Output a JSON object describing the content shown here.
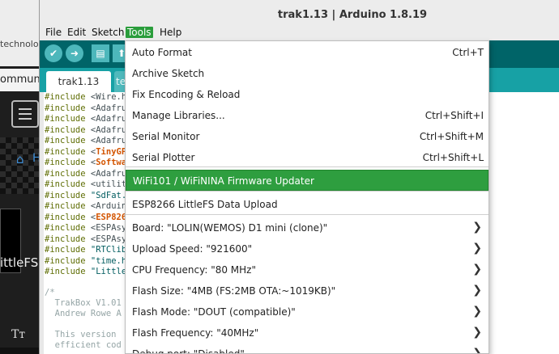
{
  "background": {
    "tab_text": "technolo",
    "community_text": "ommunit",
    "home_h": "H",
    "littlefs_text": "ittleFS",
    "tt_glyph": "Tт"
  },
  "window": {
    "title": "trak1.13 | Arduino 1.8.19"
  },
  "menubar": {
    "items": [
      "File",
      "Edit",
      "Sketch",
      "Tools",
      "Help"
    ],
    "active": "Tools"
  },
  "tabs": {
    "active": "trak1.13",
    "second": "te"
  },
  "code": {
    "includes": [
      {
        "kw": "#include",
        "lt": "<",
        "name": "Wire.h",
        "color": "lib"
      },
      {
        "kw": "#include",
        "lt": "<",
        "name": "Adafru",
        "color": "lib"
      },
      {
        "kw": "#include",
        "lt": "<",
        "name": "Adafru",
        "color": "lib"
      },
      {
        "kw": "#include",
        "lt": "<",
        "name": "Adafru",
        "color": "lib"
      },
      {
        "kw": "#include",
        "lt": "<",
        "name": "Adafru",
        "color": "lib"
      },
      {
        "kw": "#include",
        "lt": "<",
        "name": "TinyGP",
        "color": "orange"
      },
      {
        "kw": "#include",
        "lt": "<",
        "name": "Softwa",
        "color": "orange"
      },
      {
        "kw": "#include",
        "lt": "<",
        "name": "Adafru",
        "color": "lib"
      },
      {
        "kw": "#include",
        "lt": "<",
        "name": "utilit",
        "color": "lib"
      },
      {
        "kw": "#include",
        "lt": "",
        "name": "\"SdFat.",
        "color": "str"
      },
      {
        "kw": "#include",
        "lt": "<",
        "name": "Arduin",
        "color": "lib"
      },
      {
        "kw": "#include",
        "lt": "<",
        "name": "ESP826",
        "color": "orange"
      },
      {
        "kw": "#include",
        "lt": "<",
        "name": "ESPAsy",
        "color": "lib"
      },
      {
        "kw": "#include",
        "lt": "<",
        "name": "ESPAsy",
        "color": "lib"
      },
      {
        "kw": "#include",
        "lt": "",
        "name": "\"RTClib",
        "color": "str"
      },
      {
        "kw": "#include",
        "lt": "",
        "name": "\"time.h",
        "color": "str"
      },
      {
        "kw": "#include",
        "lt": "",
        "name": "\"Little",
        "color": "str"
      }
    ],
    "comments": [
      "/*",
      "  TrakBox V1.01",
      "  Andrew Rowe A",
      "",
      "  This version",
      "  efficient cod"
    ]
  },
  "tools_menu": {
    "items": [
      {
        "label": "Auto Format",
        "shortcut": "Ctrl+T"
      },
      {
        "label": "Archive Sketch",
        "shortcut": ""
      },
      {
        "label": "Fix Encoding & Reload",
        "shortcut": ""
      },
      {
        "label": "Manage Libraries...",
        "shortcut": "Ctrl+Shift+I"
      },
      {
        "label": "Serial Monitor",
        "shortcut": "Ctrl+Shift+M"
      },
      {
        "label": "Serial Plotter",
        "shortcut": "Ctrl+Shift+L"
      },
      {
        "label": "WiFi101 / WiFiNINA Firmware Updater",
        "shortcut": "",
        "highlighted": true
      },
      {
        "label": "ESP8266 LittleFS Data Upload",
        "shortcut": ""
      },
      {
        "label": "Board: \"LOLIN(WEMOS) D1 mini (clone)\"",
        "shortcut": "",
        "submenu": true
      },
      {
        "label": "Upload Speed: \"921600\"",
        "shortcut": "",
        "submenu": true
      },
      {
        "label": "CPU Frequency: \"80 MHz\"",
        "shortcut": "",
        "submenu": true
      },
      {
        "label": "Flash Size: \"4MB (FS:2MB OTA:~1019KB)\"",
        "shortcut": "",
        "submenu": true
      },
      {
        "label": "Flash Mode: \"DOUT (compatible)\"",
        "shortcut": "",
        "submenu": true
      },
      {
        "label": "Flash Frequency: \"40MHz\"",
        "shortcut": "",
        "submenu": true
      },
      {
        "label": "Debug port: \"Disabled\"",
        "shortcut": "",
        "submenu": true
      }
    ],
    "highlight_color": "#2e9e3f",
    "chevron_glyph": "❯"
  },
  "colors": {
    "toolbar": "#006468",
    "tabbar": "#17a1a5",
    "button": "#4db7bb"
  }
}
